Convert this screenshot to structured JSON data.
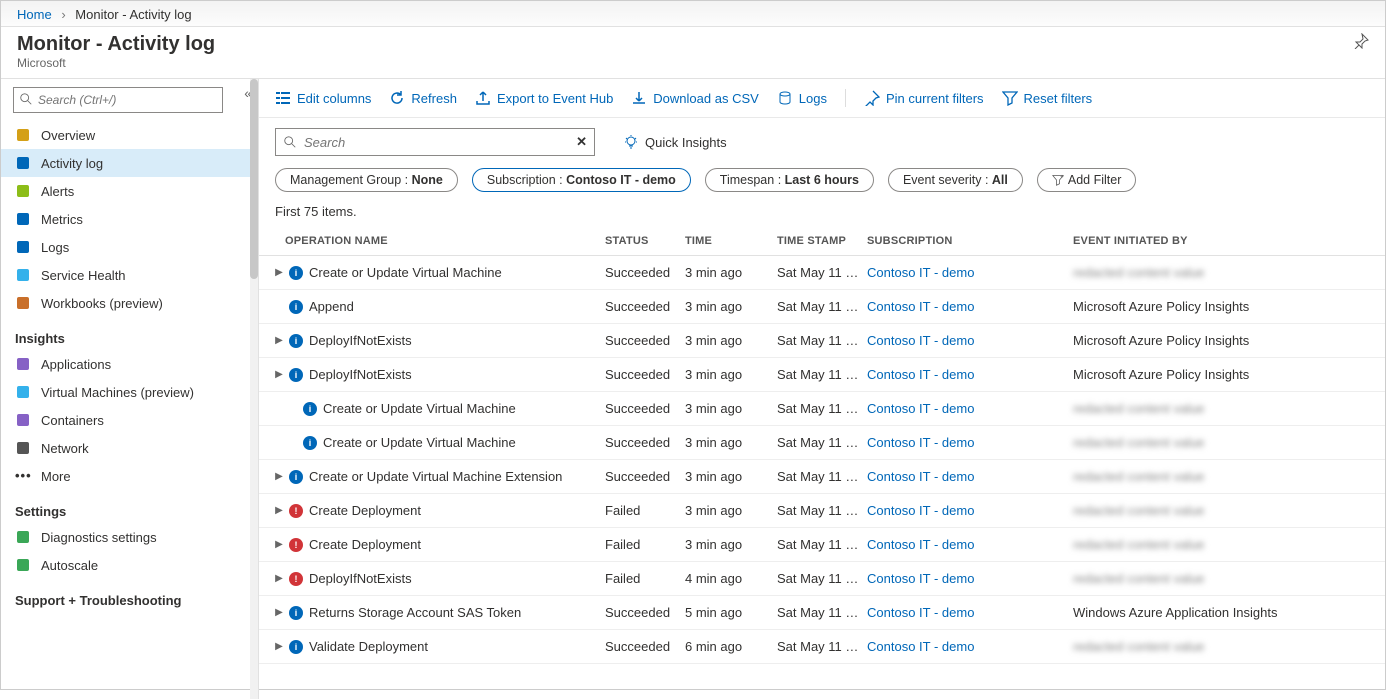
{
  "breadcrumbs": {
    "home": "Home",
    "current": "Monitor - Activity log"
  },
  "header": {
    "title": "Monitor - Activity log",
    "subtitle": "Microsoft"
  },
  "sidebar": {
    "search_placeholder": "Search (Ctrl+/)",
    "groups": [
      {
        "items": [
          {
            "label": "Overview",
            "icon": "globe-icon"
          },
          {
            "label": "Activity log",
            "icon": "log-icon",
            "active": true
          },
          {
            "label": "Alerts",
            "icon": "alert-icon"
          },
          {
            "label": "Metrics",
            "icon": "metrics-icon"
          },
          {
            "label": "Logs",
            "icon": "logs-icon"
          },
          {
            "label": "Service Health",
            "icon": "heart-icon"
          },
          {
            "label": "Workbooks (preview)",
            "icon": "workbook-icon"
          }
        ]
      },
      {
        "header": "Insights",
        "items": [
          {
            "label": "Applications",
            "icon": "bulb-icon"
          },
          {
            "label": "Virtual Machines (preview)",
            "icon": "vm-icon"
          },
          {
            "label": "Containers",
            "icon": "container-icon"
          },
          {
            "label": "Network",
            "icon": "network-icon"
          },
          {
            "label": "More",
            "icon": "more-icon"
          }
        ]
      },
      {
        "header": "Settings",
        "items": [
          {
            "label": "Diagnostics settings",
            "icon": "diag-icon"
          },
          {
            "label": "Autoscale",
            "icon": "autoscale-icon"
          }
        ]
      },
      {
        "header": "Support + Troubleshooting",
        "items": []
      }
    ]
  },
  "toolbar": {
    "edit_columns": "Edit columns",
    "refresh": "Refresh",
    "export": "Export to Event Hub",
    "download": "Download as CSV",
    "logs": "Logs",
    "pin": "Pin current filters",
    "reset": "Reset filters"
  },
  "filters": {
    "search_placeholder": "Search",
    "quick_insights": "Quick Insights",
    "pills": [
      {
        "label": "Management Group :",
        "value": "None",
        "selected": false
      },
      {
        "label": "Subscription :",
        "value": "Contoso IT - demo",
        "selected": true
      },
      {
        "label": "Timespan :",
        "value": "Last 6 hours",
        "selected": false
      },
      {
        "label": "Event severity :",
        "value": "All",
        "selected": false
      }
    ],
    "add_filter": "Add Filter"
  },
  "count_text": "First 75 items.",
  "columns": {
    "op": "OPERATION NAME",
    "status": "STATUS",
    "time": "TIME",
    "ts": "TIME STAMP",
    "sub": "SUBSCRIPTION",
    "init": "EVENT INITIATED BY"
  },
  "rows": [
    {
      "caret": true,
      "indent": 1,
      "statusKind": "info",
      "op": "Create or Update Virtual Machine",
      "status": "Succeeded",
      "time": "3 min ago",
      "ts": "Sat May 11 …",
      "sub": "Contoso IT - demo",
      "init": "",
      "blur": true
    },
    {
      "caret": false,
      "indent": 1,
      "statusKind": "info",
      "op": "Append",
      "status": "Succeeded",
      "time": "3 min ago",
      "ts": "Sat May 11 …",
      "sub": "Contoso IT - demo",
      "init": "Microsoft Azure Policy Insights"
    },
    {
      "caret": true,
      "indent": 1,
      "statusKind": "info",
      "op": "DeployIfNotExists",
      "status": "Succeeded",
      "time": "3 min ago",
      "ts": "Sat May 11 …",
      "sub": "Contoso IT - demo",
      "init": "Microsoft Azure Policy Insights"
    },
    {
      "caret": true,
      "indent": 1,
      "statusKind": "info",
      "op": "DeployIfNotExists",
      "status": "Succeeded",
      "time": "3 min ago",
      "ts": "Sat May 11 …",
      "sub": "Contoso IT - demo",
      "init": "Microsoft Azure Policy Insights"
    },
    {
      "caret": false,
      "indent": 2,
      "statusKind": "info",
      "op": "Create or Update Virtual Machine",
      "status": "Succeeded",
      "time": "3 min ago",
      "ts": "Sat May 11 …",
      "sub": "Contoso IT - demo",
      "init": "",
      "blur": true
    },
    {
      "caret": false,
      "indent": 2,
      "statusKind": "info",
      "op": "Create or Update Virtual Machine",
      "status": "Succeeded",
      "time": "3 min ago",
      "ts": "Sat May 11 …",
      "sub": "Contoso IT - demo",
      "init": "",
      "blur": true
    },
    {
      "caret": true,
      "indent": 1,
      "statusKind": "info",
      "op": "Create or Update Virtual Machine Extension",
      "status": "Succeeded",
      "time": "3 min ago",
      "ts": "Sat May 11 …",
      "sub": "Contoso IT - demo",
      "init": "",
      "blur": true
    },
    {
      "caret": true,
      "indent": 1,
      "statusKind": "err",
      "op": "Create Deployment",
      "status": "Failed",
      "time": "3 min ago",
      "ts": "Sat May 11 …",
      "sub": "Contoso IT - demo",
      "init": "",
      "blur": true
    },
    {
      "caret": true,
      "indent": 1,
      "statusKind": "err",
      "op": "Create Deployment",
      "status": "Failed",
      "time": "3 min ago",
      "ts": "Sat May 11 …",
      "sub": "Contoso IT - demo",
      "init": "",
      "blur": true
    },
    {
      "caret": true,
      "indent": 1,
      "statusKind": "err",
      "op": "DeployIfNotExists",
      "status": "Failed",
      "time": "4 min ago",
      "ts": "Sat May 11 …",
      "sub": "Contoso IT - demo",
      "init": "",
      "blur": true
    },
    {
      "caret": true,
      "indent": 1,
      "statusKind": "info",
      "op": "Returns Storage Account SAS Token",
      "status": "Succeeded",
      "time": "5 min ago",
      "ts": "Sat May 11 …",
      "sub": "Contoso IT - demo",
      "init": "Windows Azure Application Insights"
    },
    {
      "caret": true,
      "indent": 1,
      "statusKind": "info",
      "op": "Validate Deployment",
      "status": "Succeeded",
      "time": "6 min ago",
      "ts": "Sat May 11 …",
      "sub": "Contoso IT - demo",
      "init": "",
      "blur": true
    }
  ],
  "icons": {
    "globe-icon": "#d4a017",
    "log-icon": "#0067b8",
    "alert-icon": "#8cbd18",
    "metrics-icon": "#0067b8",
    "logs-icon": "#0067b8",
    "heart-icon": "#34b1eb",
    "workbook-icon": "#c96f2a",
    "bulb-icon": "#8661c5",
    "vm-icon": "#34b1eb",
    "container-icon": "#8661c5",
    "network-icon": "#555",
    "more-icon": "#555",
    "diag-icon": "#3aa757",
    "autoscale-icon": "#3aa757"
  }
}
